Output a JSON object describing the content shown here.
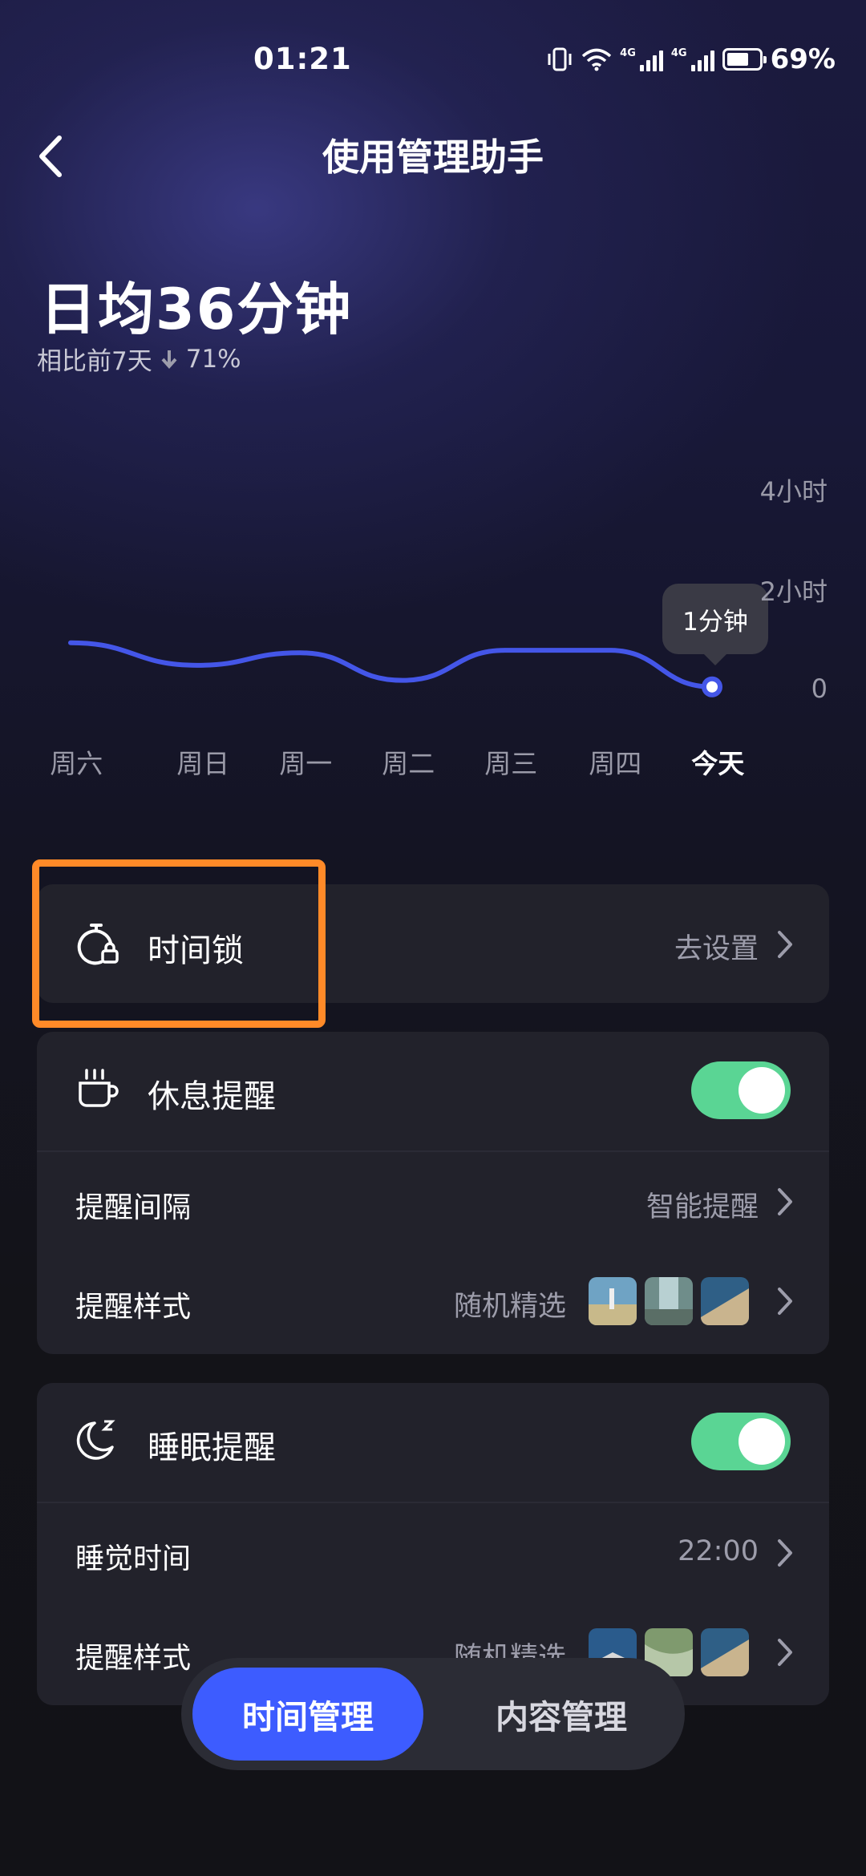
{
  "status_bar": {
    "time": "01:21",
    "network_1": "4G",
    "network_2": "4G",
    "battery_percent": "69%",
    "battery_level": 0.69
  },
  "header": {
    "title": "使用管理助手",
    "back_icon": "chevron-left-icon"
  },
  "summary": {
    "daily_average": "日均36分钟",
    "compare_label": "相比前7天",
    "compare_trend": "down-arrow-icon",
    "compare_value": "71%"
  },
  "chart_data": {
    "type": "line",
    "categories": [
      "周六",
      "周日",
      "周一",
      "周二",
      "周三",
      "周四",
      "今天"
    ],
    "y_ticks": [
      "4小时",
      "2小时",
      "0"
    ],
    "ylim_hours": [
      0,
      4
    ],
    "values_hours": [
      0.9,
      0.45,
      0.7,
      0.15,
      0.75,
      0.75,
      0.02
    ],
    "highlight_label": "1分钟",
    "line_color": "#4456e8"
  },
  "time_lock": {
    "title": "时间锁",
    "icon": "stopwatch-lock-icon",
    "action": "去设置"
  },
  "rest_reminder": {
    "title": "休息提醒",
    "icon": "coffee-cup-icon",
    "enabled": true,
    "interval_label": "提醒间隔",
    "interval_value": "智能提醒",
    "style_label": "提醒样式",
    "style_value": "随机精选"
  },
  "sleep_reminder": {
    "title": "睡眠提醒",
    "icon": "moon-sleep-icon",
    "enabled": true,
    "bedtime_label": "睡觉时间",
    "bedtime_value": "22:00",
    "style_label": "提醒样式",
    "style_value": "随机精选"
  },
  "tabs": {
    "active": "时间管理",
    "inactive": "内容管理"
  },
  "colors": {
    "toggle_on": "#5ad594",
    "accent": "#3d5cff",
    "highlight_box": "#ff8a28"
  }
}
